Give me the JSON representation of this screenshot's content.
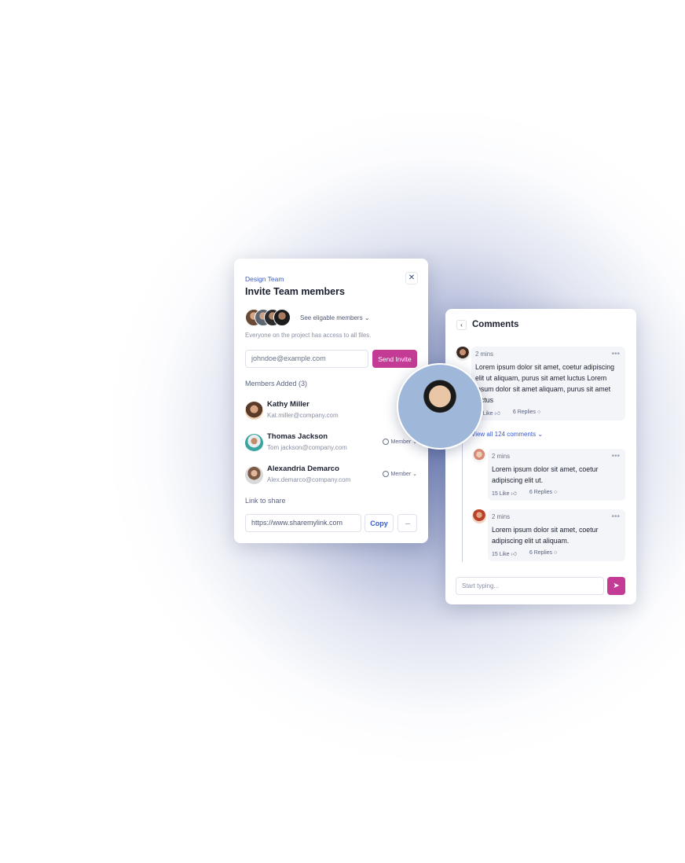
{
  "invite": {
    "kicker": "Design Team",
    "title": "Invite Team members",
    "see_eligible": "See eligable members ⌄",
    "everyone_note": "Everyone on the project has access to all files.",
    "email_value": "johndoe@example.com",
    "send_label": "Send Invite",
    "members_added": "Members Added (3)",
    "members": [
      {
        "name": "Kathy Miller",
        "email": "Kat.miller@company.com",
        "role": "Ow"
      },
      {
        "name": "Thomas Jackson",
        "email": "Tom jackson@company.com",
        "role": "Member ⌄"
      },
      {
        "name": "Alexandria Demarco",
        "email": "Alex.demarco@company.com",
        "role": "Member ⌄"
      }
    ],
    "link_label": "Link to share",
    "link_value": "https://www.sharemylink.com",
    "copy_label": "Copy",
    "more_label": "···",
    "close_label": "✕"
  },
  "comments": {
    "title": "Comments",
    "back_label": "‹",
    "view_all": "View all 124 comments ⌄",
    "input_placeholder": "Start typing...",
    "items": [
      {
        "time": "2 mins",
        "body": "Lorem ipsum dolor sit amet, coetur adipiscing elit ut aliquam, purus sit amet luctus Lorem ipsum dolor sit amet aliquam, purus sit amet luctus",
        "likes": "15 Like",
        "replies": "6 Replies"
      },
      {
        "time": "2 mins",
        "body": "Lorem ipsum dolor sit amet, coetur adipiscing elit ut.",
        "likes": "15 Like",
        "replies": "6 Replies"
      },
      {
        "time": "2 mins",
        "body": "Lorem ipsum dolor sit amet, coetur adipiscing elit ut aliquam.",
        "likes": "15 Like",
        "replies": "6 Replies"
      }
    ],
    "more_dots": "•••"
  },
  "icons": {
    "close": "close-icon",
    "gear": "gear-icon",
    "back": "chevron-left-icon",
    "like": "thumbs-up-icon",
    "reply": "comment-icon",
    "send": "rocket-icon"
  },
  "colors": {
    "accent": "#c33b94",
    "link": "#3a5bc7"
  }
}
